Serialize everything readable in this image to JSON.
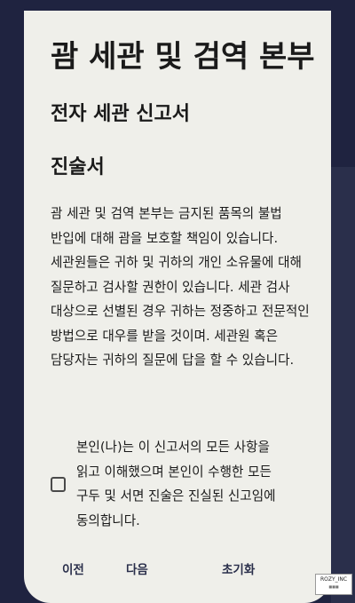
{
  "header": {
    "agency_title": "괌 세관 및 검역 본부",
    "form_title": "전자 세관 신고서",
    "section_title": "진술서"
  },
  "statement": {
    "body": "괌 세관 및 검역 본부는 금지된 품목의 불법 반입에 대해 괌을 보호할 책임이 있습니다. 세관원들은 귀하 및 귀하의 개인 소유물에 대해 질문하고 검사할 권한이 있습니다. 세관 검사 대상으로 선별된 경우 귀하는 정중하고 전문적인 방법으로 대우를 받을 것이며. 세관원 혹은 담당자는 귀하의 질문에 답을 할 수 있습니다."
  },
  "consent": {
    "checked": false,
    "label": "본인(나)는 이 신고서의 모든 사항을 읽고 이해했으며 본인이 수행한 모든 구두 및 서면 진술은 진실된 신고임에 동의합니다."
  },
  "navigation": {
    "prev_label": "이전",
    "next_label": "다음",
    "reset_label": "초기화"
  },
  "watermark": {
    "text": "ROZY_INC"
  },
  "colors": {
    "background": "#1f2340",
    "card": "#efefea",
    "nav_text": "#2a2f4b"
  }
}
